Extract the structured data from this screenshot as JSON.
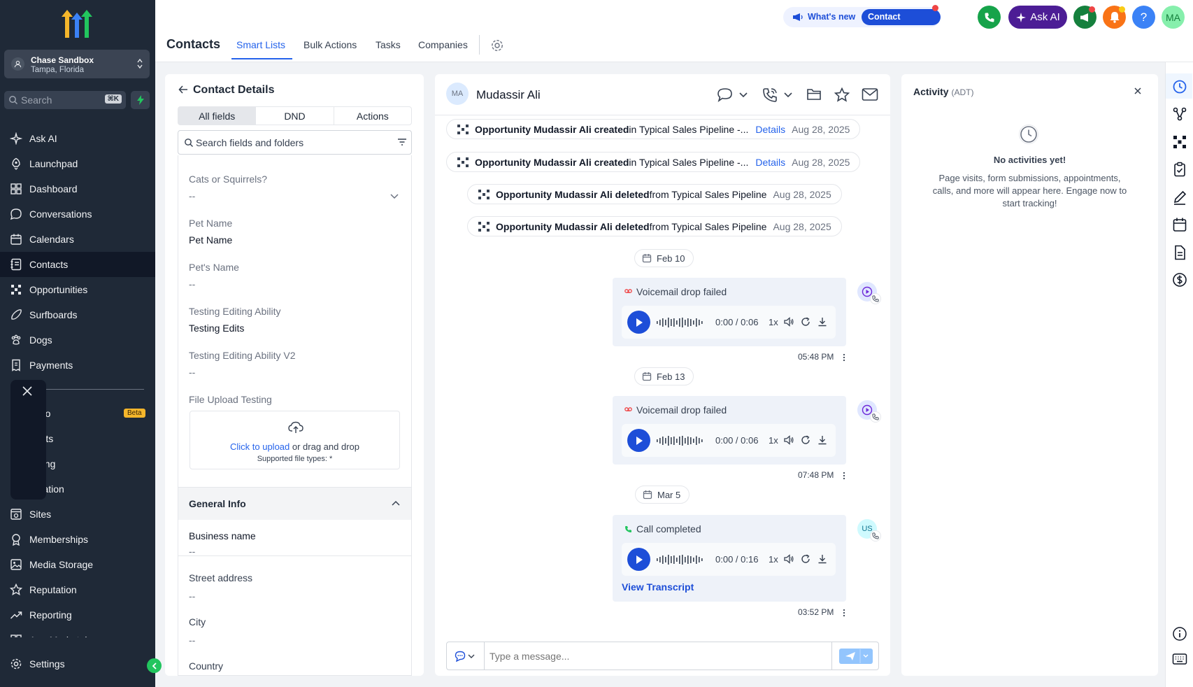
{
  "sidebar": {
    "account": {
      "name": "Chase Sandbox",
      "location": "Tampa, Florida"
    },
    "search": {
      "placeholder": "Search",
      "shortcut": "⌘K"
    },
    "items": [
      {
        "label": "Ask AI",
        "icon": "sparkle-icon"
      },
      {
        "label": "Launchpad",
        "icon": "rocket-icon"
      },
      {
        "label": "Dashboard",
        "icon": "grid-icon"
      },
      {
        "label": "Conversations",
        "icon": "chat-icon"
      },
      {
        "label": "Calendars",
        "icon": "calendar-icon"
      },
      {
        "label": "Contacts",
        "icon": "contacts-icon",
        "active": true
      },
      {
        "label": "Opportunities",
        "icon": "pipeline-icon"
      },
      {
        "label": "Surfboards",
        "icon": "surfboard-icon"
      },
      {
        "label": "Dogs",
        "icon": "paw-icon"
      },
      {
        "label": "Payments",
        "icon": "receipt-icon"
      },
      {
        "label": "tudio",
        "icon": "studio-icon",
        "badge": "Beta"
      },
      {
        "label": "gents",
        "icon": "agents-icon"
      },
      {
        "label": "keting",
        "icon": "marketing-icon"
      },
      {
        "label": "omation",
        "icon": "automation-icon"
      },
      {
        "label": "Sites",
        "icon": "sites-icon"
      },
      {
        "label": "Memberships",
        "icon": "award-icon"
      },
      {
        "label": "Media Storage",
        "icon": "image-icon"
      },
      {
        "label": "Reputation",
        "icon": "star-icon"
      },
      {
        "label": "Reporting",
        "icon": "trend-icon"
      },
      {
        "label": "App Marketplace",
        "icon": "apps-icon"
      }
    ],
    "settings": "Settings"
  },
  "topbar": {
    "title": "Contacts",
    "tabs": [
      "Smart Lists",
      "Bulk Actions",
      "Tasks",
      "Companies"
    ],
    "whats_new": "What's new",
    "contact_updates": "Contact updates",
    "ask_ai": "Ask AI",
    "help": "?",
    "user_initials": "MA",
    "colors": {
      "phone": "#16a34a",
      "ask_ai": "#4c1d95",
      "announce": "#15803d",
      "bell": "#f97316",
      "help": "#3b82f6",
      "avatar": "#86efac"
    }
  },
  "details": {
    "back": "←",
    "title": "Contact Details",
    "segments": [
      "All fields",
      "DND",
      "Actions"
    ],
    "search_placeholder": "Search fields and folders",
    "fields": [
      {
        "label": "Cats or Squirrels?",
        "value": "--"
      },
      {
        "label": "Pet Name",
        "value": "Pet Name"
      },
      {
        "label": "Pet's Name",
        "value": "--"
      },
      {
        "label": "Testing Editing Ability",
        "value": "Testing Edits"
      },
      {
        "label": "Testing Editing Ability V2",
        "value": "--"
      },
      {
        "label": "File Upload Testing",
        "value": ""
      }
    ],
    "upload": {
      "link": "Click to upload",
      "rest": " or drag and drop",
      "types": "Supported file types: *"
    },
    "general_info": {
      "title": "General Info",
      "fields": [
        {
          "label": "Business name",
          "value": "--"
        },
        {
          "label": "Street address",
          "value": "--"
        },
        {
          "label": "City",
          "value": "--"
        },
        {
          "label": "Country",
          "value": ""
        }
      ]
    }
  },
  "conversation": {
    "initials": "MA",
    "name": "Mudassir Ali",
    "events": [
      {
        "bold": "Opportunity Mudassir Ali created",
        "rest": " in Typical Sales Pipeline -...",
        "link": "Details",
        "date": "Aug 28, 2025"
      },
      {
        "bold": "Opportunity Mudassir Ali created",
        "rest": " in Typical Sales Pipeline -...",
        "link": "Details",
        "date": "Aug 28, 2025"
      },
      {
        "bold": "Opportunity Mudassir Ali deleted",
        "rest": " from Typical Sales Pipeline",
        "link": "",
        "date": "Aug 28, 2025"
      },
      {
        "bold": "Opportunity Mudassir Ali deleted",
        "rest": " from Typical Sales Pipeline",
        "link": "",
        "date": "Aug 28, 2025"
      }
    ],
    "dates": [
      "Feb 10",
      "Feb 13",
      "Mar 5"
    ],
    "messages": [
      {
        "status": "Voicemail drop failed",
        "time": "0:00 / 0:06",
        "speed": "1x",
        "stamp": "05:48 PM",
        "transcript": ""
      },
      {
        "status": "Voicemail drop failed",
        "time": "0:00 / 0:06",
        "speed": "1x",
        "stamp": "07:48 PM",
        "transcript": ""
      },
      {
        "status": "Call completed",
        "time": "0:00 / 0:16",
        "speed": "1x",
        "stamp": "03:52 PM",
        "transcript": "View Transcript",
        "avatar": "US"
      }
    ],
    "composer_placeholder": "Type a message..."
  },
  "activity": {
    "title": "Activity",
    "tz": "(ADT)",
    "empty_title": "No activities yet!",
    "empty_text": "Page visits, form submissions, appointments, calls, and more will appear here. Engage now to start tracking!"
  }
}
